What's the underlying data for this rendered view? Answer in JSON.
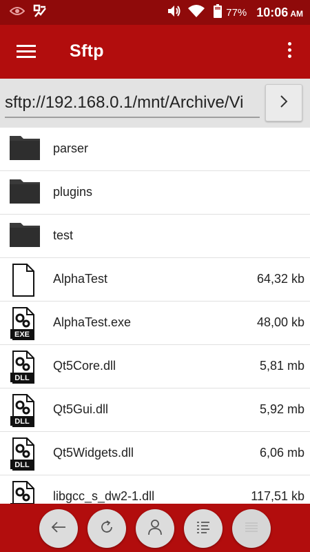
{
  "status_bar": {
    "battery_percent": "77%",
    "time": "10:06",
    "ampm": "AM",
    "icons": [
      "eye-icon",
      "app-check-icon",
      "volume-icon",
      "wifi-icon",
      "battery-icon"
    ]
  },
  "app_bar": {
    "title": "Sftp",
    "icons": [
      "menu-icon",
      "more-vert-icon"
    ]
  },
  "path": {
    "value": "sftp://192.168.0.1/mnt/Archive/Vi",
    "go_icon": "chevron-right-icon"
  },
  "files": [
    {
      "name": "parser",
      "size": "",
      "type": "folder"
    },
    {
      "name": "plugins",
      "size": "",
      "type": "folder"
    },
    {
      "name": "test",
      "size": "",
      "type": "folder"
    },
    {
      "name": "AlphaTest",
      "size": "64,32 kb",
      "type": "file"
    },
    {
      "name": "AlphaTest.exe",
      "size": "48,00 kb",
      "type": "exe"
    },
    {
      "name": "Qt5Core.dll",
      "size": "5,81 mb",
      "type": "dll"
    },
    {
      "name": "Qt5Gui.dll",
      "size": "5,92 mb",
      "type": "dll"
    },
    {
      "name": "Qt5Widgets.dll",
      "size": "6,06 mb",
      "type": "dll"
    },
    {
      "name": "libgcc_s_dw2-1.dll",
      "size": "117,51 kb",
      "type": "dll"
    }
  ],
  "file_badges": {
    "exe": "EXE",
    "dll": "DLL"
  },
  "bottom_bar": {
    "buttons": [
      "back-arrow-icon",
      "refresh-icon",
      "user-icon",
      "list-view-icon",
      "list-view-disabled-icon"
    ]
  },
  "colors": {
    "status_bar": "#8f0a0a",
    "app_bar": "#b20d0d",
    "path_bar": "#e3e3e3",
    "folder": "#3a3a3a"
  }
}
